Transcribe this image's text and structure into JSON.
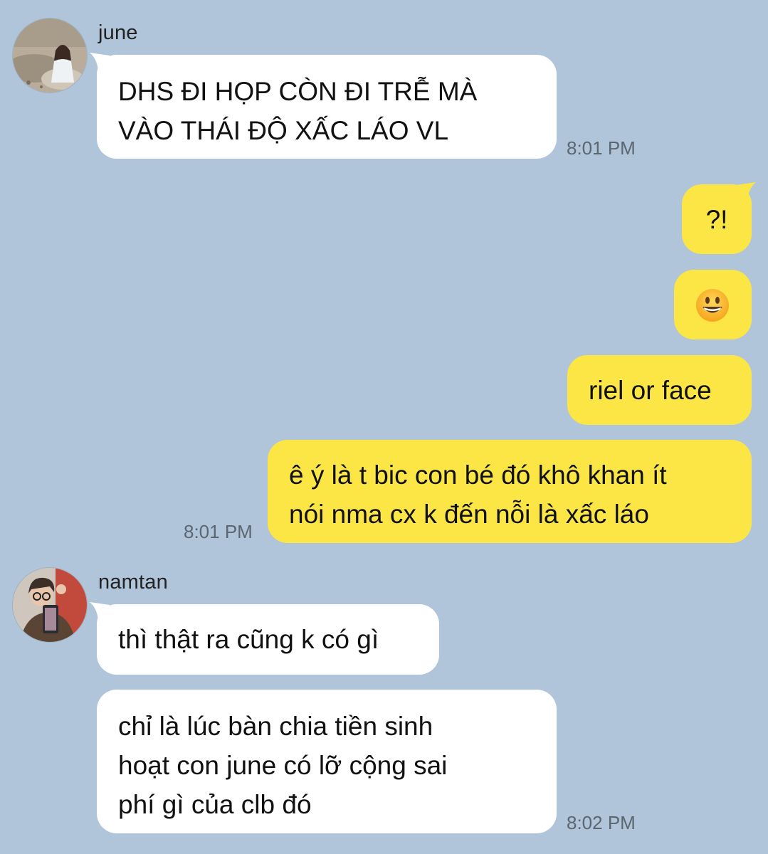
{
  "colors": {
    "background": "#b0c5da",
    "incoming_bubble": "#ffffff",
    "outgoing_bubble": "#fbe645",
    "timestamp": "#5b6670"
  },
  "messages": {
    "group1": {
      "sender": "june",
      "avatar_icon": "avatar-photo-june",
      "text_line1": "DHS ĐI HỌP CÒN ĐI TRỄ MÀ",
      "text_line2": "VÀO THÁI ĐỘ XẤC LÁO VL",
      "time": "8:01 PM"
    },
    "outgoing": {
      "msg1": "?!",
      "msg2_icon": "grinning-face-emoji",
      "msg3": "riel or face",
      "msg4_line1": "ê ý là t bic con bé đó khô khan ít",
      "msg4_line2": "nói nma cx k đến nỗi là xấc láo",
      "time": "8:01 PM"
    },
    "group2": {
      "sender": "namtan",
      "avatar_icon": "avatar-photo-namtan",
      "msg1": "thì thật ra cũng k có gì",
      "msg2_line1": "chỉ là lúc bàn chia tiền sinh",
      "msg2_line2": "hoạt con june có lỡ cộng sai",
      "msg2_line3": "phí gì của clb đó",
      "time": "8:02 PM"
    }
  }
}
